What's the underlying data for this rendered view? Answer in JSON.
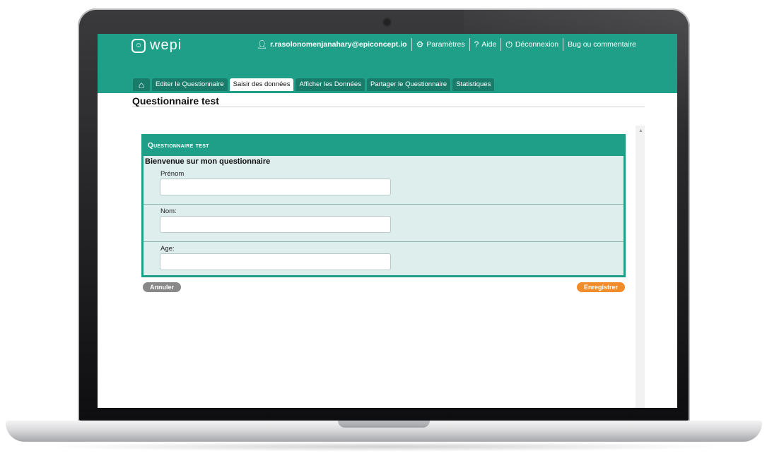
{
  "brand": {
    "name": "wepi",
    "logo_icon": "smiley-icon"
  },
  "userbar": {
    "email": "r.rasolonomenjanahary@epiconcept.io",
    "settings": "Paramètres",
    "help_glyph": "?",
    "help": "Aide",
    "logout": "Déconnexion",
    "feedback": "Bug ou commentaire"
  },
  "tabs": [
    {
      "label": "Editer le Questionnaire",
      "active": false
    },
    {
      "label": "Saisir des données",
      "active": true
    },
    {
      "label": "Afficher les Données",
      "active": false
    },
    {
      "label": "Partager le Questionnaire",
      "active": false
    },
    {
      "label": "Statistiques",
      "active": false
    }
  ],
  "page": {
    "title": "Questionnaire test"
  },
  "form": {
    "header": "Questionnaire test",
    "welcome": "Bienvenue sur mon questionnaire",
    "fields": [
      {
        "label": "Prénom",
        "value": ""
      },
      {
        "label": "Nom:",
        "value": ""
      },
      {
        "label": "Age:",
        "value": ""
      }
    ]
  },
  "buttons": {
    "cancel": "Annuler",
    "save": "Enregistrer"
  },
  "colors": {
    "accent": "#1f9f88",
    "tab_bg": "#197c6b",
    "form_bg": "#ddeeed",
    "save": "#f28c2a",
    "cancel": "#888888"
  }
}
